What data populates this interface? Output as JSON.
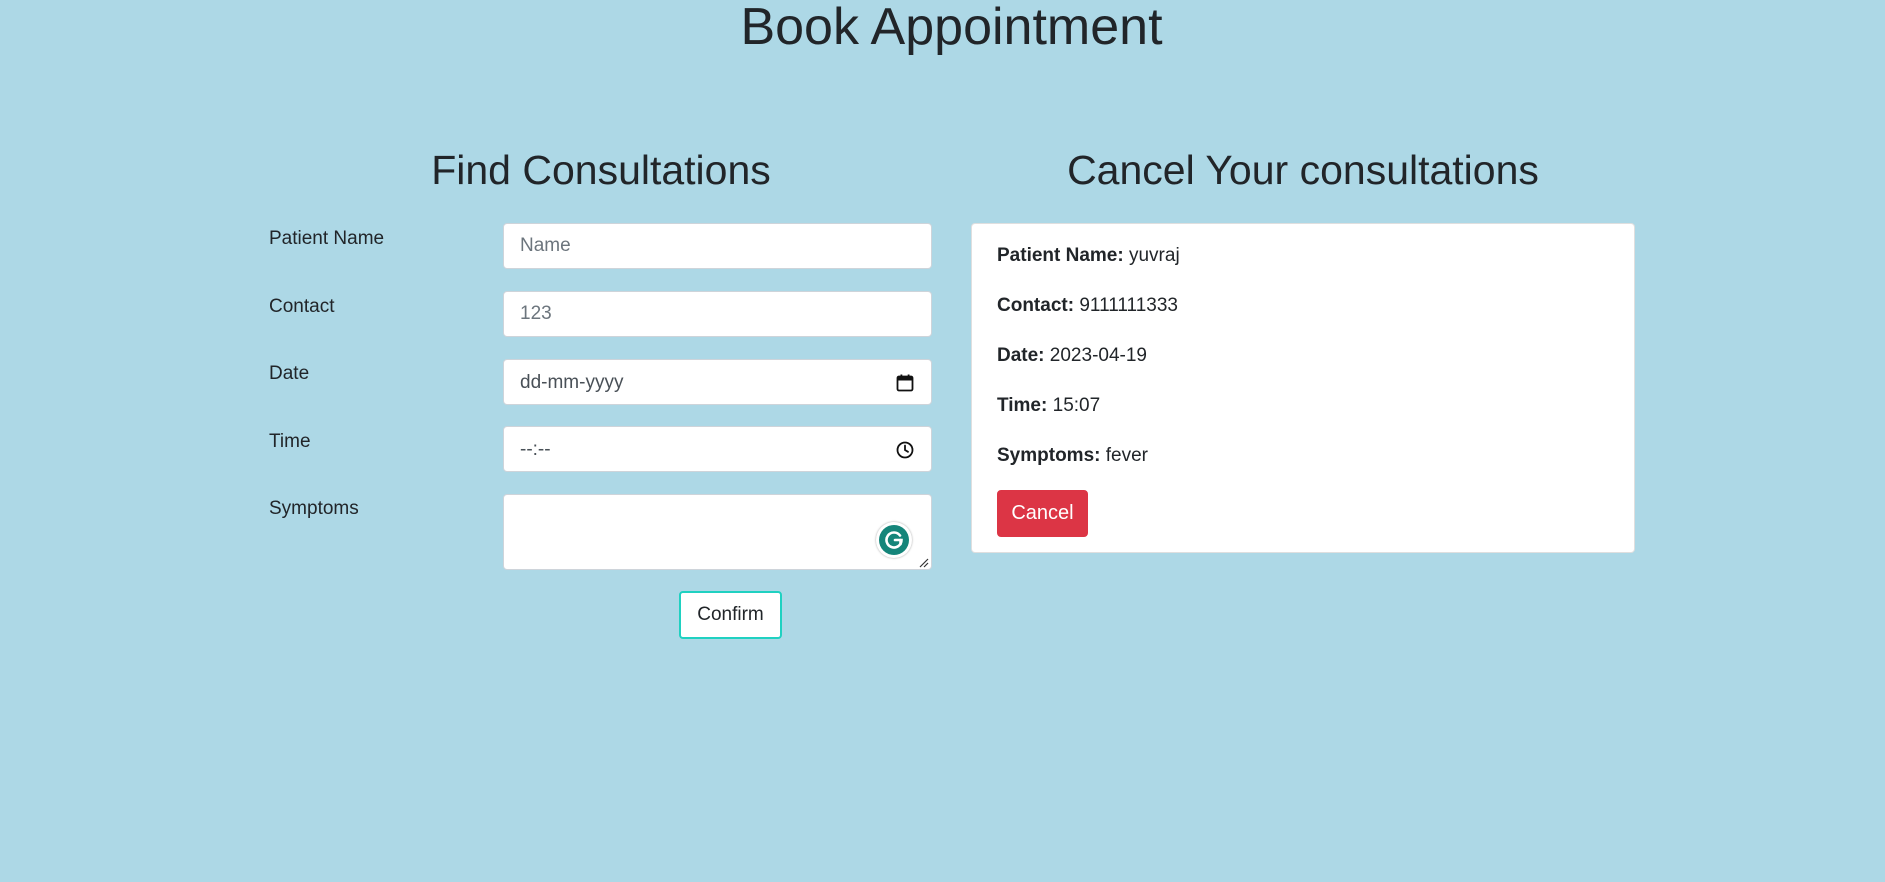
{
  "page": {
    "title": "Book Appointment",
    "background_color": "#add8e6"
  },
  "find_form": {
    "title": "Find Consultations",
    "fields": {
      "patient_name": {
        "label": "Patient Name",
        "placeholder": "Name"
      },
      "contact": {
        "label": "Contact",
        "placeholder": "123"
      },
      "date": {
        "label": "Date",
        "display": "dd-mm-yyyy",
        "icon": "calendar-icon"
      },
      "time": {
        "label": "Time",
        "display": "--:--",
        "icon": "clock-icon"
      },
      "symptoms": {
        "label": "Symptoms",
        "value": ""
      }
    },
    "confirm_label": "Confirm",
    "confirm_border_color": "#1fd1c1"
  },
  "cancel_card": {
    "title": "Cancel Your consultations",
    "details": {
      "patient_name": {
        "label": "Patient Name:",
        "value": "yuvraj"
      },
      "contact": {
        "label": "Contact:",
        "value": "9111111333"
      },
      "date": {
        "label": "Date:",
        "value": "2023-04-19"
      },
      "time": {
        "label": "Time:",
        "value": "15:07"
      },
      "symptoms": {
        "label": "Symptoms:",
        "value": "fever"
      }
    },
    "cancel_label": "Cancel",
    "cancel_color": "#dc3545"
  },
  "extension": {
    "icon": "grammarly-icon",
    "color": "#15857a"
  }
}
